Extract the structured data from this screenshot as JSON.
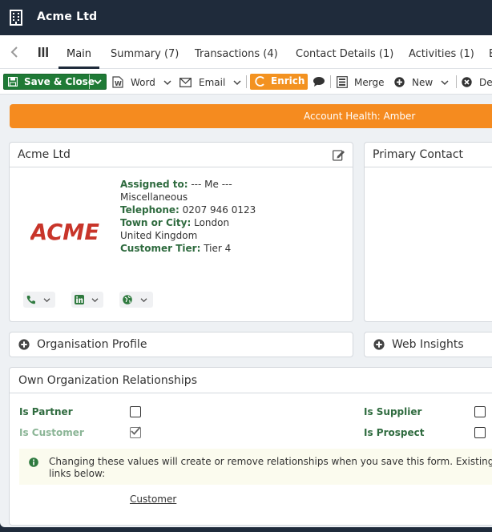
{
  "window": {
    "title": "Acme Ltd"
  },
  "tabs": [
    {
      "label": "Main"
    },
    {
      "label": "Summary (7)"
    },
    {
      "label": "Transactions (4)"
    },
    {
      "label": "Contact Details (1)"
    },
    {
      "label": "Activities (1)"
    },
    {
      "label": "E"
    }
  ],
  "toolbar": {
    "save_close": "Save & Close",
    "word": "Word",
    "email": "Email",
    "enrich": "Enrich",
    "merge": "Merge",
    "new": "New",
    "delete": "De"
  },
  "banner": {
    "text": "Account Health: Amber",
    "color": "#f58b1f"
  },
  "account_card": {
    "title": "Acme Ltd",
    "logo_text": "ACME",
    "assigned_label": "Assigned to:",
    "assigned_value": "--- Me ---",
    "category": "Miscellaneous",
    "telephone_label": "Telephone:",
    "telephone_value": "0207 946 0123",
    "town_label": "Town or City:",
    "town_value": "London",
    "country": "United Kingdom",
    "tier_label": "Customer Tier:",
    "tier_value": "Tier 4"
  },
  "primary_contact": {
    "title": "Primary Contact"
  },
  "organisation_profile": {
    "title": "Organisation Profile"
  },
  "web_insights": {
    "title": "Web Insights"
  },
  "relationships": {
    "title": "Own Organization Relationships",
    "is_partner": {
      "label": "Is Partner",
      "checked": false
    },
    "is_customer": {
      "label": "Is Customer",
      "checked": true
    },
    "is_supplier": {
      "label": "Is Supplier",
      "checked": false
    },
    "is_prospect": {
      "label": "Is Prospect",
      "checked": false
    },
    "note_line1": "Changing these values will create or remove relationships when you save this form. Existing re",
    "note_line2": "links below:",
    "link_customer": "Customer"
  },
  "colors": {
    "brand_green": "#1f7a36",
    "enrich_orange": "#f39220",
    "header_bg": "#1f2b3b",
    "label_green": "#2f6b3f"
  }
}
